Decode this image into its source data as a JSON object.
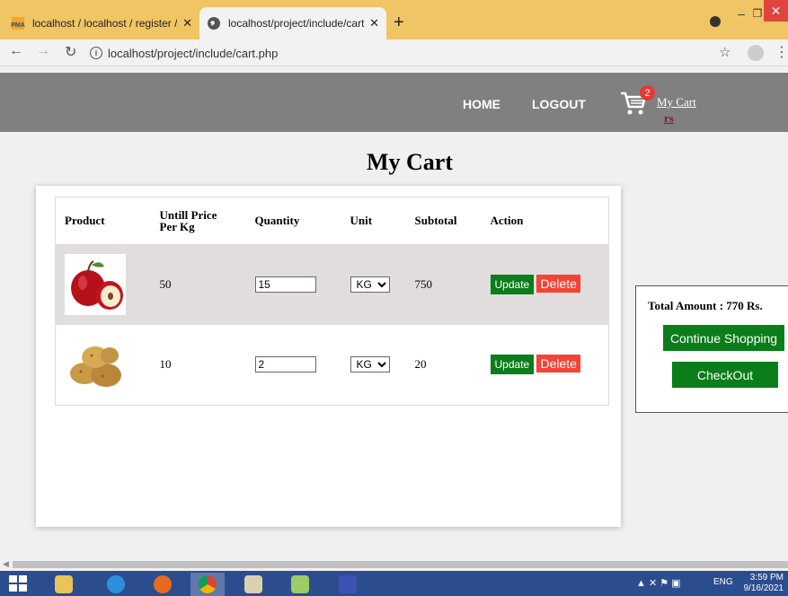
{
  "browser": {
    "tabs": [
      {
        "title": "localhost / localhost / register / s",
        "active": false
      },
      {
        "title": "localhost/project/include/cart.ph",
        "active": true
      }
    ],
    "new_tab": "+",
    "url": "localhost/project/include/cart.php"
  },
  "site_nav": {
    "home": "HOME",
    "logout": "LOGOUT",
    "cart_count": "2",
    "cart_label": "My Cart",
    "cart_rs": "rs"
  },
  "page": {
    "title": "My Cart"
  },
  "table": {
    "headers": {
      "product": "Product",
      "price": "Untill Price Per Kg",
      "quantity": "Quantity",
      "unit": "Unit",
      "subtotal": "Subtotal",
      "action": "Action"
    },
    "rows": [
      {
        "product_icon": "apple-image",
        "price": "50",
        "quantity": "15",
        "unit": "KG",
        "subtotal": "750",
        "update": "Update",
        "delete": "Delete"
      },
      {
        "product_icon": "potato-image",
        "price": "10",
        "quantity": "2",
        "unit": "KG",
        "subtotal": "20",
        "update": "Update",
        "delete": "Delete"
      }
    ]
  },
  "summary": {
    "total": "Total Amount : 770 Rs.",
    "continue": "Continue Shopping",
    "checkout": "CheckOut"
  },
  "taskbar": {
    "language": "ENG",
    "time": "3:59 PM",
    "date": "9/16/2021"
  },
  "colors": {
    "nav_bg": "#808080",
    "button_green": "#0b7d1a",
    "delete_red": "#f44336",
    "tab_strip": "#f0c564"
  }
}
